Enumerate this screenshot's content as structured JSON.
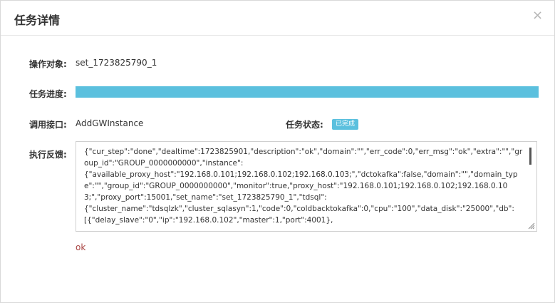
{
  "dialog": {
    "title": "任务详情",
    "close_glyph": "×"
  },
  "fields": {
    "target_label": "操作对象:",
    "target_value": "set_1723825790_1",
    "progress_label": "任务进度:",
    "progress_percent": 100,
    "progress_color": "#5bc0de",
    "interface_label": "调用接口:",
    "interface_value": "AddGWInstance",
    "status_label": "任务状态:",
    "status_badge": "已完成",
    "feedback_label": "执行反馈:",
    "feedback_text": "{\"cur_step\":\"done\",\"dealtime\":1723825901,\"description\":\"ok\",\"domain\":\"\",\"err_code\":0,\"err_msg\":\"ok\",\"extra\":\"\",\"group_id\":\"GROUP_0000000000\",\"instance\":\n{\"available_proxy_host\":\"192.168.0.101;192.168.0.102;192.168.0.103;\",\"dctokafka\":false,\"domain\":\"\",\"domain_type\":\"\",\"group_id\":\"GROUP_0000000000\",\"monitor\":true,\"proxy_host\":\"192.168.0.101;192.168.0.102;192.168.0.103;\",\"proxy_port\":15001,\"set_name\":\"set_1723825790_1\",\"tdsql\":\n{\"cluster_name\":\"tdsqlzk\",\"cluster_sqlasyn\":1,\"code\":0,\"coldbacktokafka\":0,\"cpu\":\"100\",\"data_disk\":\"25000\",\"db\":\n[{\"delay_slave\":\"0\",\"ip\":\"192.168.0.102\",\"master\":1,\"port\":4001},",
    "result_text": "ok"
  }
}
